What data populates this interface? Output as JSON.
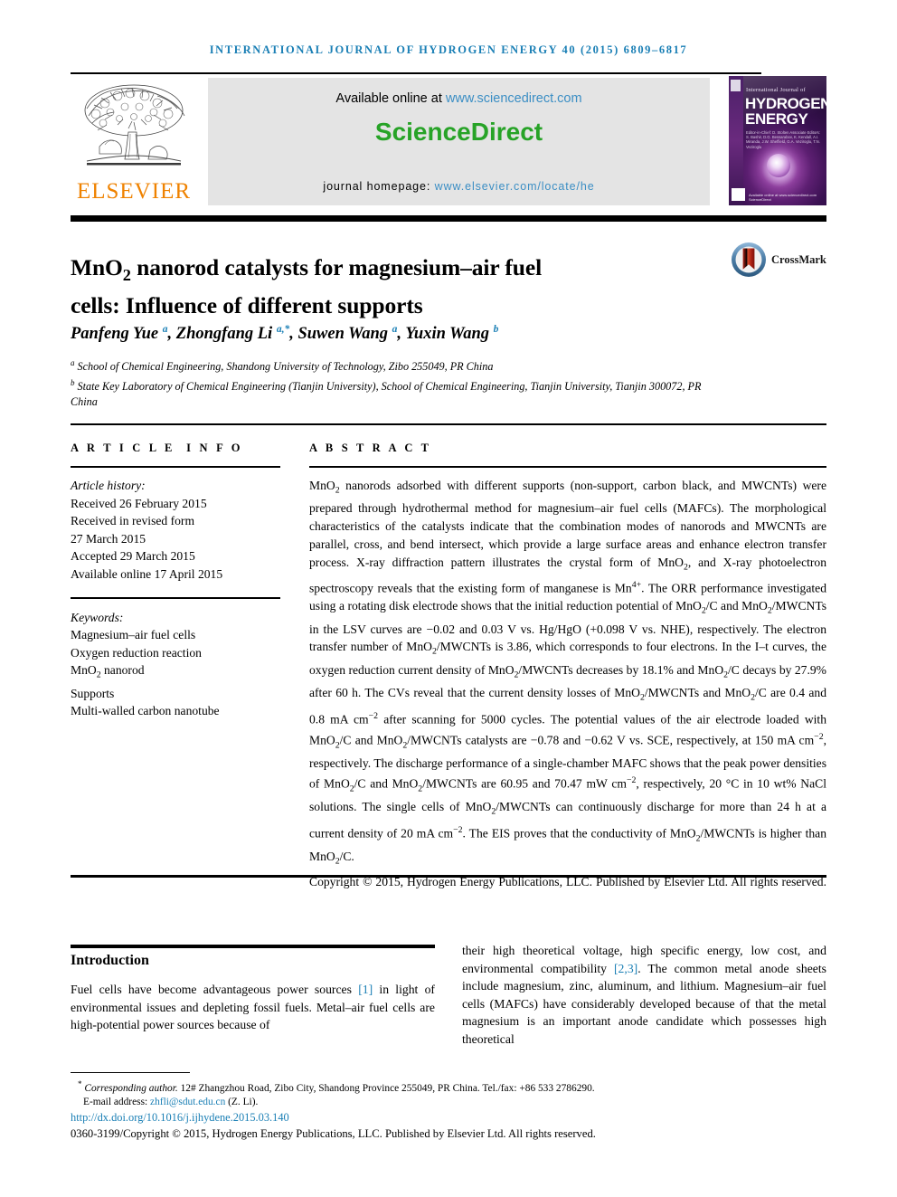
{
  "running_head": "INTERNATIONAL JOURNAL OF HYDROGEN ENERGY 40 (2015) 6809–6817",
  "banner": {
    "elsevier_wordmark": "ELSEVIER",
    "available_prefix": "Available online at ",
    "available_url": "www.sciencedirect.com",
    "sciencedirect_logo": "ScienceDirect",
    "homepage_prefix": "journal homepage: ",
    "homepage_url": "www.elsevier.com/locate/he",
    "colors": {
      "elsevier_orange": "#ef8200",
      "sciencedirect_green": "#27a327",
      "link_blue": "#3b8ec4",
      "box_grey": "#e4e4e4"
    }
  },
  "cover": {
    "top_line": "International Journal of",
    "title_line1": "HYDROGEN",
    "title_line2": "ENERGY",
    "editors": "Editor-in-Chief: D. Stolten\nAssociate Editors: S. Bashir, D.G. Bessarabov, K. Kendall, A.I. Miranda, J.W. Sheffield, G.A. Veziroglu, T.N. Veziroglu",
    "footer_text": "Available online at www.sciencedirect.com\nScienceDirect"
  },
  "article": {
    "title_line1": "MnO₂ nanorod catalysts for magnesium–air fuel",
    "title_line2": "cells: Influence of different supports",
    "crossmark_label": "CrossMark",
    "authors": [
      {
        "name": "Panfeng Yue",
        "marks": "a"
      },
      {
        "name": "Zhongfang Li",
        "marks": "a,*"
      },
      {
        "name": "Suwen Wang",
        "marks": "a"
      },
      {
        "name": "Yuxin Wang",
        "marks": "b"
      }
    ],
    "affiliations": [
      {
        "mark": "a",
        "text": "School of Chemical Engineering, Shandong University of Technology, Zibo 255049, PR China"
      },
      {
        "mark": "b",
        "text": "State Key Laboratory of Chemical Engineering (Tianjin University), School of Chemical Engineering, Tianjin University, Tianjin 300072, PR China"
      }
    ]
  },
  "article_info": {
    "heading": "ARTICLE INFO",
    "history_label": "Article history:",
    "history": [
      "Received 26 February 2015",
      "Received in revised form",
      "27 March 2015",
      "Accepted 29 March 2015",
      "Available online 17 April 2015"
    ],
    "keywords_label": "Keywords:",
    "keywords": [
      "Magnesium–air fuel cells",
      "Oxygen reduction reaction",
      "MnO₂ nanorod",
      "Supports",
      "Multi-walled carbon nanotube"
    ]
  },
  "abstract": {
    "heading": "ABSTRACT",
    "text": "MnO₂ nanorods adsorbed with different supports (non-support, carbon black, and MWCNTs) were prepared through hydrothermal method for magnesium–air fuel cells (MAFCs). The morphological characteristics of the catalysts indicate that the combination modes of nanorods and MWCNTs are parallel, cross, and bend intersect, which provide a large surface areas and enhance electron transfer process. X-ray diffraction pattern illustrates the crystal form of MnO₂, and X-ray photoelectron spectroscopy reveals that the existing form of manganese is Mn⁴⁺. The ORR performance investigated using a rotating disk electrode shows that the initial reduction potential of MnO₂/C and MnO₂/MWCNTs in the LSV curves are −0.02 and 0.03 V vs. Hg/HgO (+0.098 V vs. NHE), respectively. The electron transfer number of MnO₂/MWCNTs is 3.86, which corresponds to four electrons. In the I–t curves, the oxygen reduction current density of MnO₂/MWCNTs decreases by 18.1% and MnO₂/C decays by 27.9% after 60 h. The CVs reveal that the current density losses of MnO₂/MWCNTs and MnO₂/C are 0.4 and 0.8 mA cm⁻² after scanning for 5000 cycles. The potential values of the air electrode loaded with MnO₂/C and MnO₂/MWCNTs catalysts are −0.78 and −0.62 V vs. SCE, respectively, at 150 mA cm⁻², respectively. The discharge performance of a single-chamber MAFC shows that the peak power densities of MnO₂/C and MnO₂/MWCNTs are 60.95 and 70.47 mW cm⁻², respectively, 20 °C in 10 wt% NaCl solutions. The single cells of MnO₂/MWCNTs can continuously discharge for more than 24 h at a current density of 20 mA cm⁻². The EIS proves that the conductivity of MnO₂/MWCNTs is higher than MnO₂/C.",
    "copyright": "Copyright © 2015, Hydrogen Energy Publications, LLC. Published by Elsevier Ltd. All rights reserved."
  },
  "introduction": {
    "heading": "Introduction",
    "left_paragraph": "Fuel cells have become advantageous power sources [1] in light of environmental issues and depleting fossil fuels. Metal–air fuel cells are high-potential power sources because of",
    "left_ref": "[1]",
    "right_paragraph": "their high theoretical voltage, high specific energy, low cost, and environmental compatibility [2,3]. The common metal anode sheets include magnesium, zinc, aluminum, and lithium. Magnesium–air fuel cells (MAFCs) have considerably developed because of that the metal magnesium is an important anode candidate which possesses high theoretical",
    "right_ref": "[2,3]"
  },
  "footer": {
    "corresponding_marker": "*",
    "corresponding_label": "Corresponding author.",
    "corresponding_text": " 12# Zhangzhou Road, Zibo City, Shandong Province 255049, PR China. Tel./fax: +86 533 2786290.",
    "email_label": "E-mail address:",
    "email": "zhfli@sdut.edu.cn",
    "email_owner": "(Z. Li).",
    "doi": "http://dx.doi.org/10.1016/j.ijhydene.2015.03.140",
    "issn_line": "0360-3199/Copyright © 2015, Hydrogen Energy Publications, LLC. Published by Elsevier Ltd. All rights reserved."
  }
}
